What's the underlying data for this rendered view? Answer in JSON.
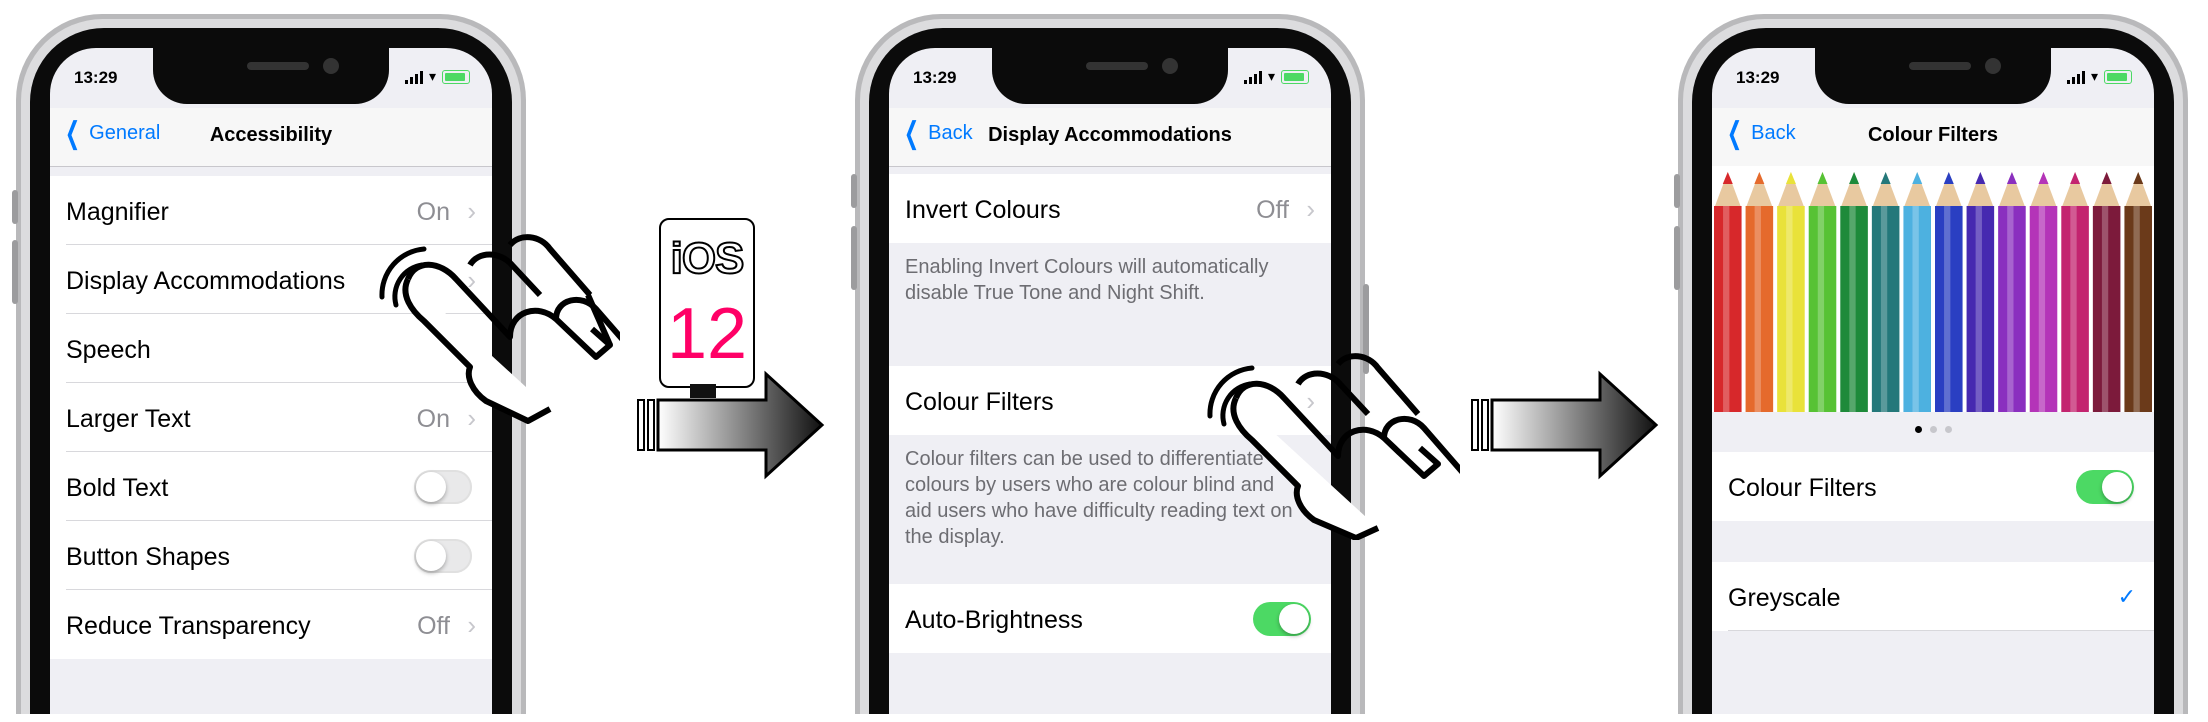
{
  "screens": [
    {
      "status_time": "13:29",
      "back_label": "General",
      "title": "Accessibility",
      "rows": [
        {
          "label": "Magnifier",
          "value": "On"
        },
        {
          "label": "Display Accommodations",
          "value": ""
        },
        {
          "label": "Speech",
          "value": ""
        },
        {
          "label": "Larger Text",
          "value": "On"
        },
        {
          "label": "Bold Text",
          "toggle": false
        },
        {
          "label": "Button Shapes",
          "toggle": false
        },
        {
          "label": "Reduce Transparency",
          "value": "Off"
        }
      ]
    },
    {
      "status_time": "13:29",
      "back_label": "Back",
      "title": "Display Accommodations",
      "rows": [
        {
          "label": "Invert Colours",
          "value": "Off"
        },
        {
          "label": "Colour Filters",
          "value": ""
        },
        {
          "label": "Auto-Brightness",
          "toggle": true
        }
      ],
      "footers": [
        "Enabling Invert Colours will automatically disable True Tone and Night Shift.",
        "Colour filters can be used to differentiate colours by users who are colour blind and aid users who have difficulty reading text on the display."
      ]
    },
    {
      "status_time": "13:29",
      "back_label": "Back",
      "title": "Colour Filters",
      "rows": [
        {
          "label": "Colour Filters",
          "toggle": true
        },
        {
          "label": "Greyscale",
          "checked": true
        }
      ],
      "pencil_colors": [
        "#d7282b",
        "#e56a2c",
        "#e9e23a",
        "#57c234",
        "#1e8a3a",
        "#24787a",
        "#4db1e0",
        "#2a3fc2",
        "#4629b0",
        "#8a2fbf",
        "#b434b8",
        "#c3246f",
        "#7c1a3b",
        "#6b3a1a"
      ],
      "carousel_pages": 3,
      "carousel_active": 0
    }
  ],
  "badge": {
    "os": "iOS",
    "version": "12"
  },
  "colors": {
    "accent": "#007aff",
    "switch_on": "#4cd964",
    "toggle_off": "#e9e9ea"
  }
}
